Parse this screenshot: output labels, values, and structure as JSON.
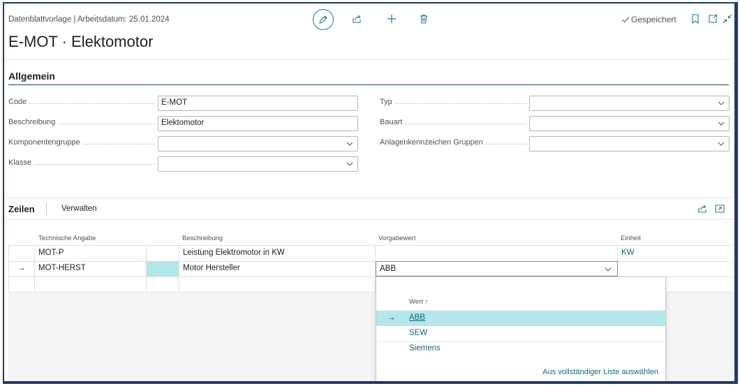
{
  "header": {
    "subtitle": "Datenblattvorlage | Arbeitsdatum: 25.01.2024",
    "title": "E-MOT · Elektomotor",
    "saved_label": "Gespeichert",
    "icons": [
      "pencil-icon",
      "share-icon",
      "plus-icon",
      "trash-icon",
      "bookmark-icon",
      "open-new-icon",
      "collapse-icon"
    ]
  },
  "general": {
    "section_title": "Allgemein",
    "fields_left": [
      {
        "label": "Code",
        "value": "E-MOT",
        "type": "text"
      },
      {
        "label": "Beschreibung",
        "value": "Elektomotor",
        "type": "text"
      },
      {
        "label": "Komponentengruppe",
        "value": "",
        "type": "select"
      },
      {
        "label": "Klasse",
        "value": "",
        "type": "select"
      }
    ],
    "fields_right": [
      {
        "label": "Typ",
        "value": "",
        "type": "select"
      },
      {
        "label": "Bauart",
        "value": "",
        "type": "select"
      },
      {
        "label": "Anlagenkennzeichen Gruppen",
        "value": "",
        "type": "select"
      }
    ]
  },
  "lines": {
    "title": "Zeilen",
    "manage_label": "Verwalten",
    "columns": [
      "Technische Angabe",
      "Beschreibung",
      "Vorgabewert",
      "Einheit"
    ],
    "rows": [
      {
        "marker": "",
        "code": "MOT-P",
        "description": "Leistung Elektromotor in KW",
        "value": "",
        "unit": "KW"
      },
      {
        "marker": "→",
        "code": "MOT-HERST",
        "description": "Motor Hersteller",
        "value": "ABB",
        "unit": ""
      },
      {
        "marker": "",
        "code": "",
        "description": "",
        "value": "",
        "unit": ""
      }
    ]
  },
  "dropdown": {
    "column_header": "Wert ↑",
    "options": [
      {
        "marker": "→",
        "label": "ABB",
        "selected": true
      },
      {
        "marker": "",
        "label": "SEW",
        "selected": false
      },
      {
        "marker": "",
        "label": "Siemens",
        "selected": false
      }
    ],
    "full_list_link": "Aus vollständiger Liste auswählen"
  },
  "colors": {
    "accent": "#0f6c7a",
    "selected_row": "#b3e6ea",
    "frame": "#1e3b6b"
  }
}
